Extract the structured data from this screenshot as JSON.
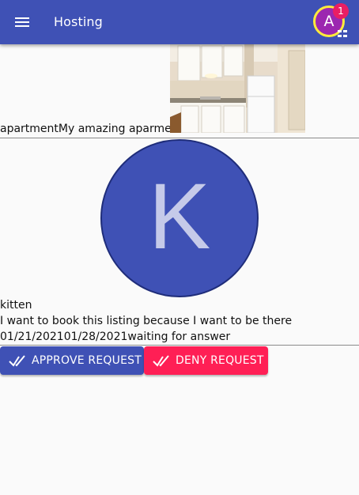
{
  "appbar": {
    "title": "Hosting",
    "avatar_letter": "A",
    "notification_count": "1",
    "colors": {
      "bar": "#3f51b5",
      "avatar_bg": "#9c27b0",
      "avatar_ring": "#ffeb3b",
      "badge": "#e91e63"
    },
    "icons": [
      "menu-icon",
      "apps-dots-icon"
    ]
  },
  "listing": {
    "type": "apartment",
    "title": "My amazing aparment",
    "photo": "kitchen-photo"
  },
  "request": {
    "avatar_letter": "K",
    "username": "kitten",
    "message": "I want to book this listing because I want to be there",
    "start_date": "01/21/2021",
    "end_date": "01/28/2021",
    "status": "waiting for answer"
  },
  "actions": {
    "approve_label": "Approve request",
    "deny_label": "Deny request",
    "colors": {
      "approve": "#3f51b5",
      "deny": "#ff1f55"
    },
    "icon": "done-all-icon"
  }
}
